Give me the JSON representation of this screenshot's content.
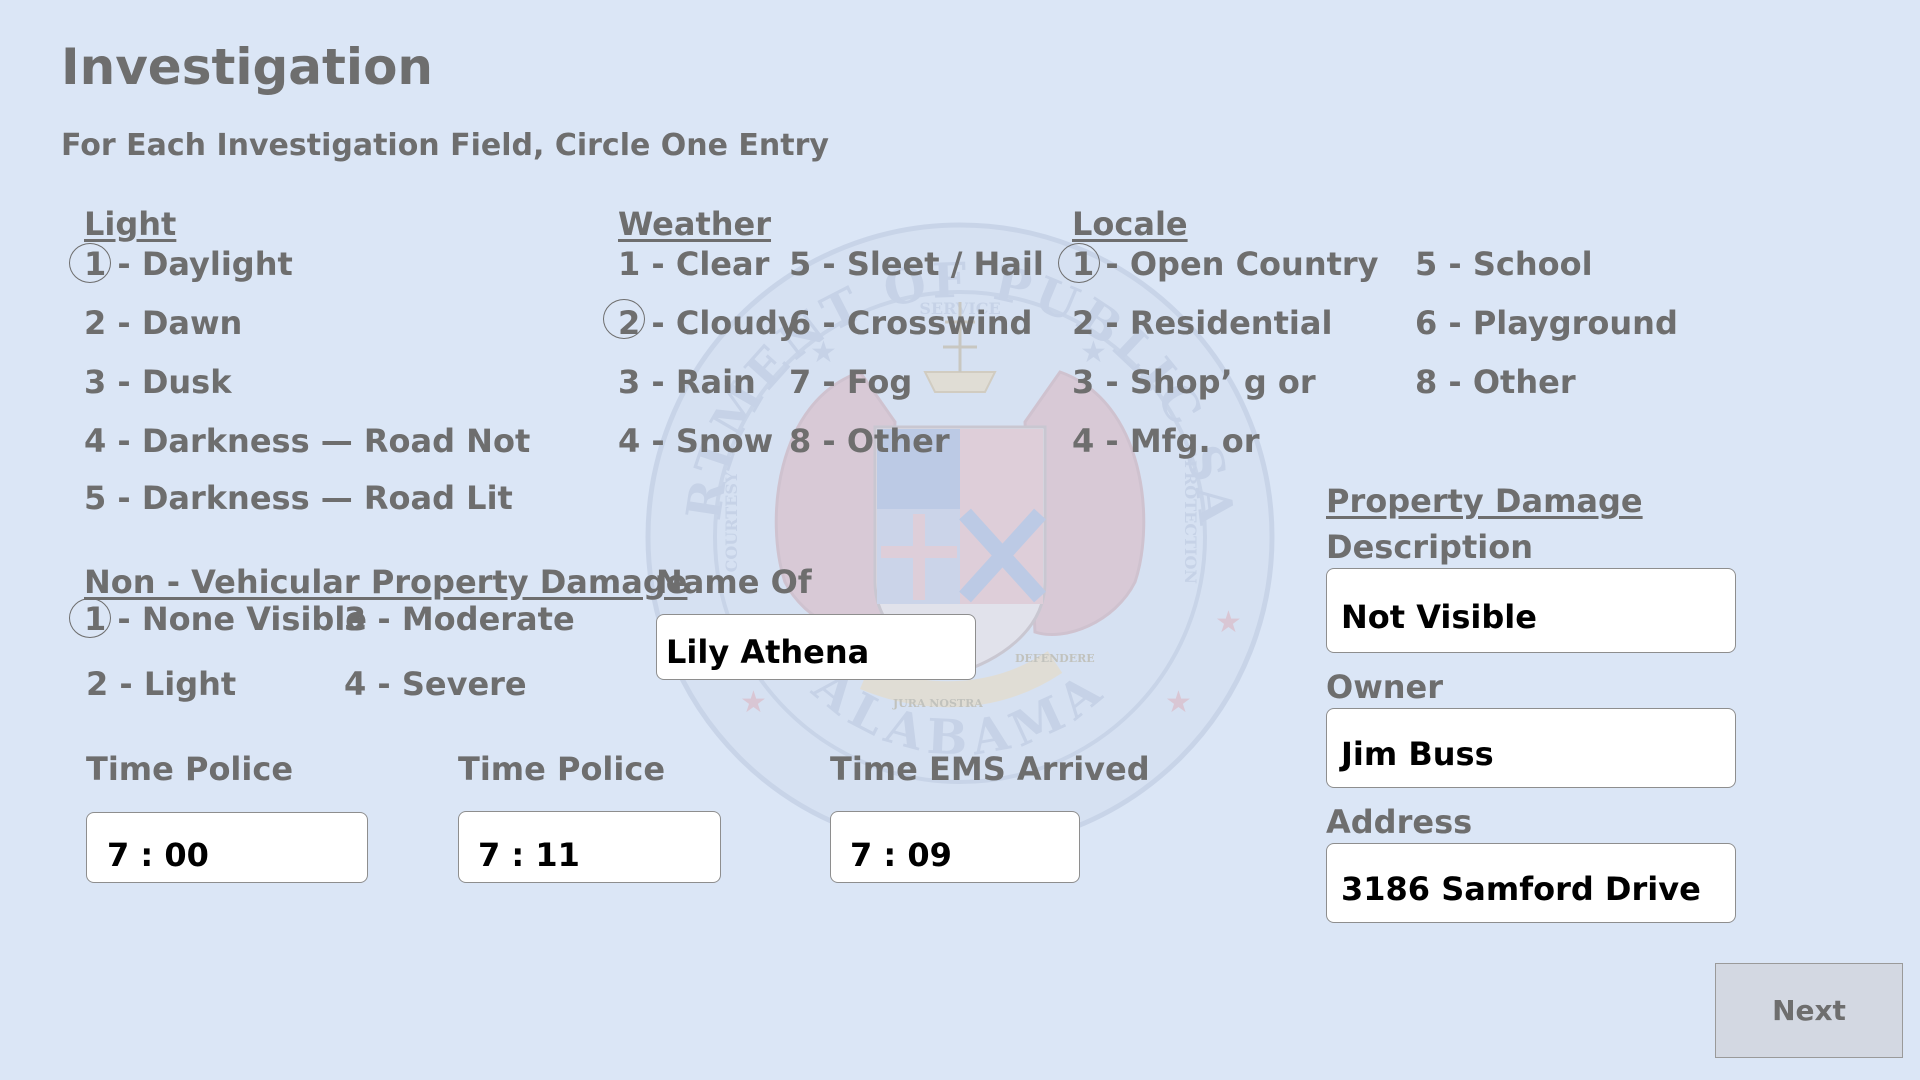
{
  "page": {
    "title": "Investigation",
    "subtitle": "For Each Investigation Field, Circle One Entry"
  },
  "seal": {
    "text_top": "DEPARTMENT OF PUBLIC SAFETY",
    "text_bottom": "ALABAMA",
    "text_service": "SERVICE",
    "text_courtesy": "COURTESY",
    "text_protection": "PROTECTION",
    "text_motto_left": "JURA NOSTRA",
    "text_motto_right": "DEFENDERE"
  },
  "light": {
    "header": "Light",
    "options": [
      "1 - Daylight",
      "2 - Dawn",
      "3 - Dusk",
      "4 - Darkness — Road Not",
      "5 - Darkness — Road Lit"
    ],
    "selected": "1 - Daylight"
  },
  "weather": {
    "header": "Weather",
    "options_col1": [
      "1 - Clear",
      "2 - Cloudy",
      "3 - Rain",
      "4 - Snow"
    ],
    "options_col2": [
      "5 - Sleet / Hail",
      "6 - Crosswind",
      "7 - Fog",
      "8 - Other"
    ],
    "selected": "2 - Cloudy"
  },
  "locale": {
    "header": "Locale",
    "options_col1": [
      "1 - Open Country",
      "2 - Residential",
      "3 - Shop’  g or",
      "4 - Mfg. or"
    ],
    "options_col2": [
      "5 - School",
      "6 - Playground",
      "8 - Other"
    ],
    "selected": "1 - Open Country"
  },
  "non_vehicular": {
    "header": "Non - Vehicular Property Damage",
    "options_col1": [
      "1 - None Visible",
      "2 - Light"
    ],
    "options_col2": [
      "3 - Moderate",
      "4 - Severe"
    ],
    "selected": "1 - None Visible"
  },
  "name_of": {
    "label": "Name Of",
    "value": "Lily Athena"
  },
  "times": [
    {
      "label": "Time Police",
      "value": "7 : 00"
    },
    {
      "label": "Time Police",
      "value": "7 : 11"
    },
    {
      "label": "Time EMS Arrived",
      "value": "7 : 09"
    }
  ],
  "property_damage": {
    "header": "Property Damage",
    "description_label": "Description",
    "description_value": "Not Visible",
    "owner_label": "Owner",
    "owner_value": "Jim Buss",
    "address_label": "Address",
    "address_value": "3186 Samford Drive"
  },
  "next_button": {
    "label": "Next"
  }
}
